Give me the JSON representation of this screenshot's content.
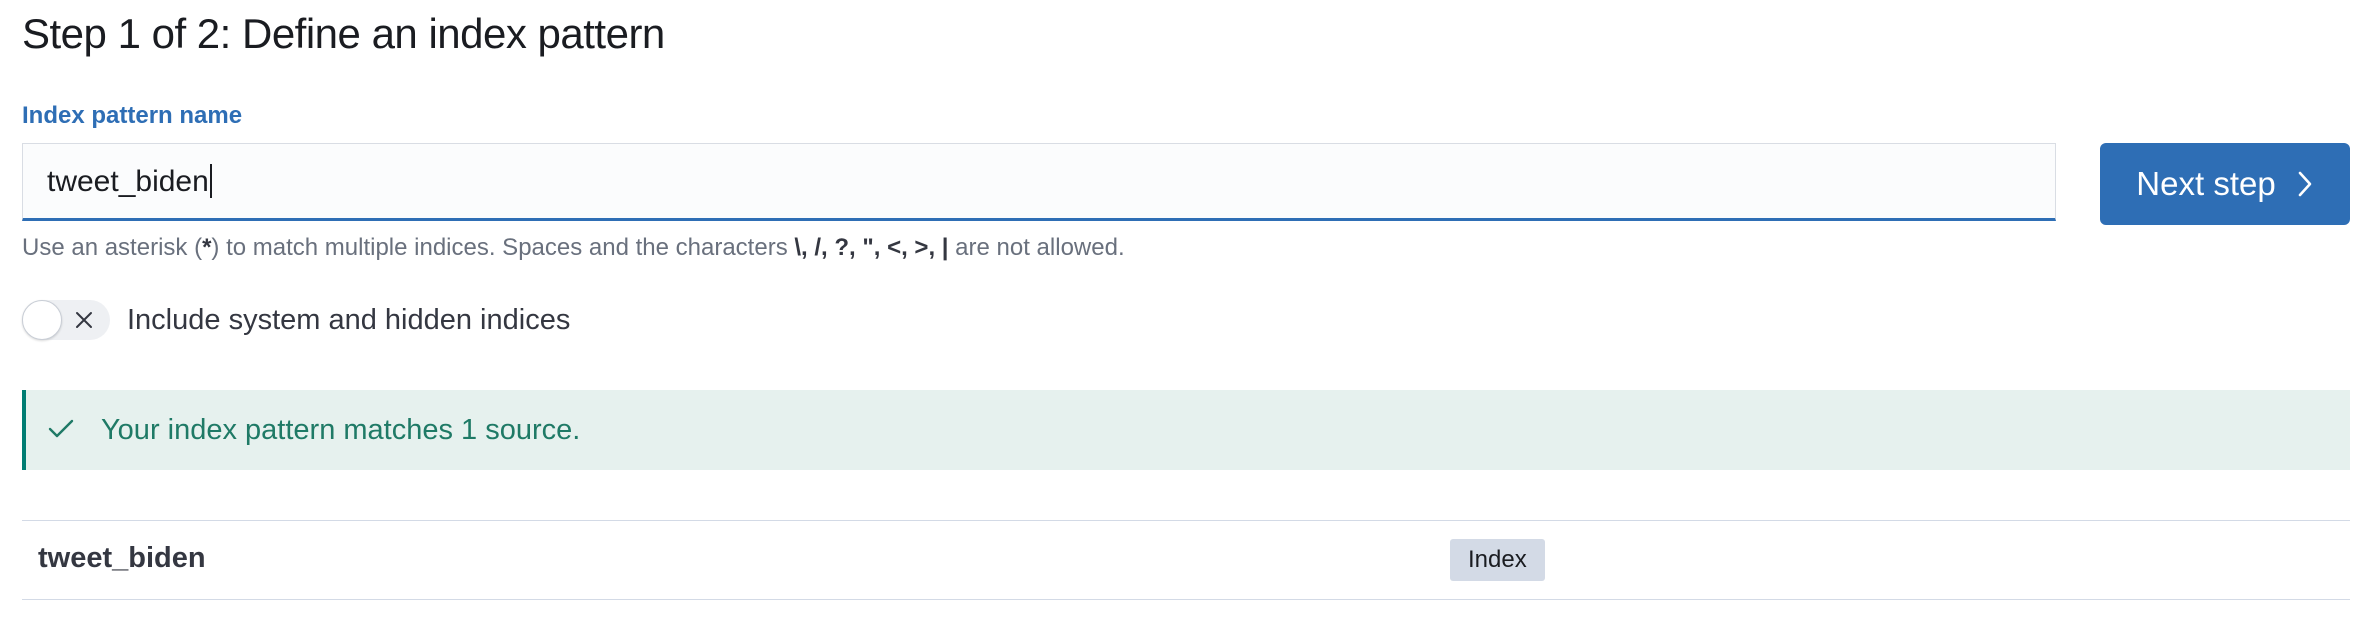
{
  "header": {
    "title": "Step 1 of 2: Define an index pattern"
  },
  "form": {
    "field_label": "Index pattern name",
    "input_value": "tweet_biden",
    "next_button_label": "Next step",
    "help": {
      "prefix": "Use an asterisk (",
      "asterisk": "*",
      "middle": ") to match multiple indices. Spaces and the characters ",
      "chars": "\\, /, ?, \", <, >, |",
      "suffix": " are not allowed."
    },
    "toggle": {
      "label": "Include system and hidden indices",
      "checked": false
    }
  },
  "callout": {
    "message": "Your index pattern matches 1 source.",
    "color": "#017d73"
  },
  "results": {
    "rows": [
      {
        "name": "tweet_biden",
        "badge": "Index"
      }
    ]
  },
  "colors": {
    "accent": "#2e6eb5",
    "success": "#017d73"
  },
  "icons": {
    "next_button": "chevron-right-icon",
    "toggle": "cross-icon",
    "callout": "check-icon"
  }
}
